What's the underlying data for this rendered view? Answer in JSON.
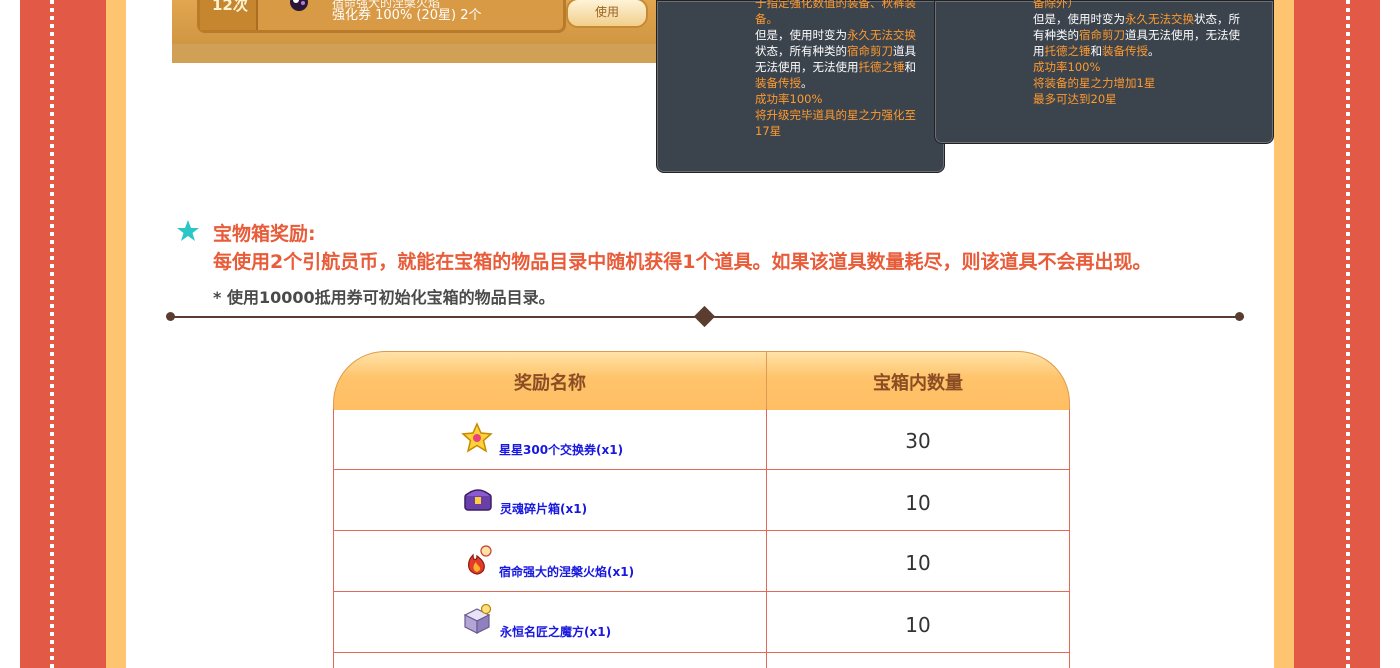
{
  "coupon": {
    "count": "12次",
    "title": "宿命强大的涅槃火焰",
    "text": "强化券 100% (20星) 2个",
    "use_label": "使用"
  },
  "tooltip_left": {
    "line1": "于指定强化数值的装备、秋裤装",
    "line2": "备。",
    "line3a": "但是，使用时变为",
    "line3b": "永久无法交换",
    "line4a": "状态，所有种类的",
    "line4b": "宿命剪刀",
    "line4c": "道具",
    "line5a": "无法使用，无法使用",
    "line5b": "托德之锤",
    "line5c": "和",
    "line6a": "装备传授",
    "line6b": "。",
    "line7": "成功率100%",
    "line8": "将升级完毕道具的星之力强化至",
    "line9": "17星"
  },
  "tooltip_right": {
    "line1": "备除外）",
    "line2a": "但是，使用时变为",
    "line2b": "永久无法交换",
    "line2c": "状态，所",
    "line3a": "有种类的",
    "line3b": "宿命剪刀",
    "line3c": "道具无法使用，无法使",
    "line4a": "用",
    "line4b": "托德之锤",
    "line4c": "和",
    "line4d": "装备传授",
    "line4e": "。",
    "line5": "成功率100%",
    "line6": "将装备的星之力增加1星",
    "line7": "最多可达到20星"
  },
  "treasure": {
    "title": "宝物箱奖励:",
    "description": "每使用2个引航员币，就能在宝箱的物品目录中随机获得1个道具。如果该道具数量耗尽，则该道具不会再出现。",
    "note": "* 使用10000抵用券可初始化宝箱的物品目录。"
  },
  "table": {
    "headers": [
      "奖励名称",
      "宝箱内数量"
    ],
    "rows": [
      {
        "name": "星星300个交换券(x1)",
        "qty": "30",
        "icon": "star-coupon-icon"
      },
      {
        "name": "灵魂碎片箱(x1)",
        "qty": "10",
        "icon": "treasure-chest-icon"
      },
      {
        "name": "宿命强大的涅槃火焰(x1)",
        "qty": "10",
        "icon": "flame-icon"
      },
      {
        "name": "永恒名匠之魔方(x1)",
        "qty": "10",
        "icon": "cube-icon"
      }
    ]
  },
  "colors": {
    "accent_red": "#e25a45",
    "accent_orange": "#ffc46f",
    "heading_text": "#e85c3a",
    "item_link": "#1818e0",
    "tooltip_bg": "#3b434d",
    "tooltip_highlight": "#ff9a2f"
  }
}
